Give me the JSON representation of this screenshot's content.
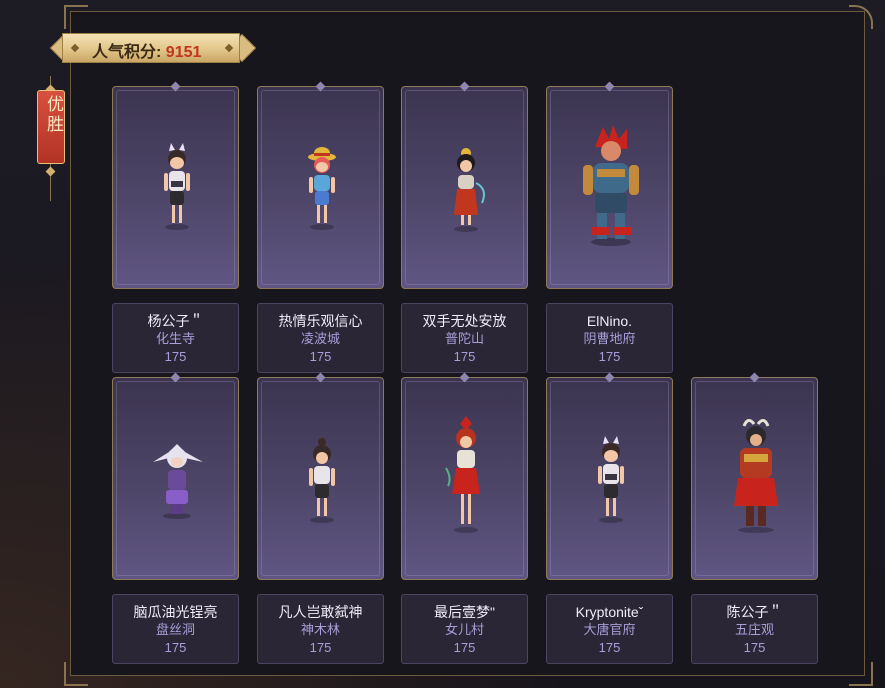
{
  "score": {
    "label": "人气积分:",
    "value": "9151"
  },
  "rank_tag": "优胜",
  "cards": [
    {
      "name": "杨公子＂",
      "school": "化生寺",
      "points": "175",
      "avatar": "boy-cat-ears-avatar"
    },
    {
      "name": "热情乐观信心",
      "school": "凌波城",
      "points": "175",
      "avatar": "boy-straw-hat-avatar"
    },
    {
      "name": "双手无处安放",
      "school": "普陀山",
      "points": "175",
      "avatar": "girl-red-dress-avatar"
    },
    {
      "name": "ElNino.",
      "school": "阴曹地府",
      "points": "175",
      "avatar": "red-hair-warrior-avatar"
    },
    {
      "name": "脑瓜油光锃亮",
      "school": "盘丝洞",
      "points": "175",
      "avatar": "white-hair-girl-avatar"
    },
    {
      "name": "凡人岂敢弑神",
      "school": "神木林",
      "points": "175",
      "avatar": "boy-ponytail-avatar"
    },
    {
      "name": "最后壹梦\"",
      "school": "女儿村",
      "points": "175",
      "avatar": "girl-red-outfit-avatar"
    },
    {
      "name": "Kryptoniteˇ",
      "school": "大唐官府",
      "points": "175",
      "avatar": "boy-cat-ears-avatar"
    },
    {
      "name": "陈公子＂",
      "school": "五庄观",
      "points": "175",
      "avatar": "monkey-armor-avatar"
    }
  ],
  "colors": {
    "accent_red": "#c0361f",
    "gold": "#d9bd80",
    "school_text": "#a89fd8"
  }
}
